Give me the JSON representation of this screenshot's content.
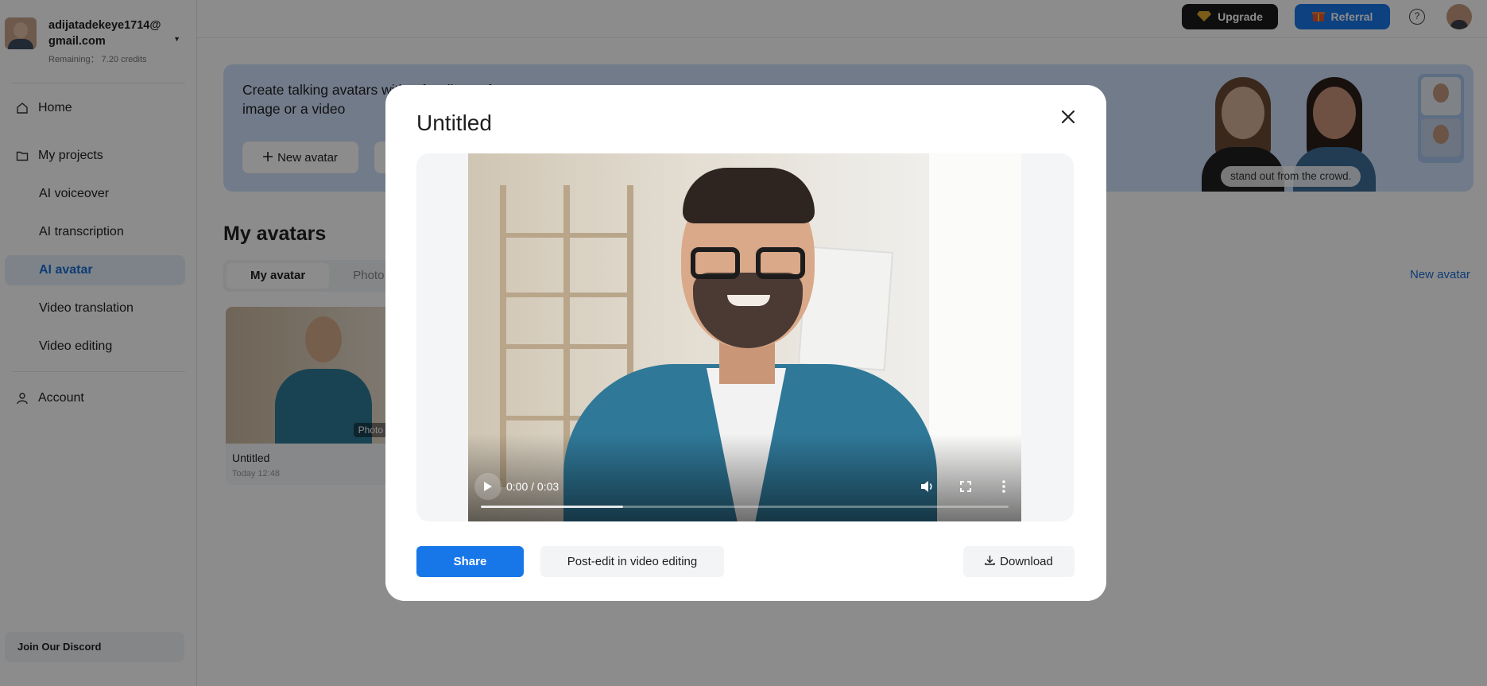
{
  "account": {
    "email": "adijatadekeye1714@gmail.com",
    "credits": "Remaining： 7.20 credits"
  },
  "sidebar": {
    "items": [
      {
        "label": "Home",
        "icon": "home-icon"
      },
      {
        "label": "My projects",
        "icon": "folder-icon"
      },
      {
        "label": "AI voiceover"
      },
      {
        "label": "AI transcription"
      },
      {
        "label": "AI avatar",
        "active": true
      },
      {
        "label": "Video translation"
      },
      {
        "label": "Video editing"
      },
      {
        "label": "Account",
        "icon": "user-icon"
      }
    ],
    "discord_label": "Join Our Discord"
  },
  "topbar": {
    "upgrade_label": "Upgrade",
    "referral_label": "Referral",
    "help_icon": "?"
  },
  "banner": {
    "text": "Create talking avatars with a few lines of text or an image or a video",
    "new_avatar_label": "New avatar",
    "tagline": "stand out from the crowd."
  },
  "main": {
    "section_title": "My avatars",
    "tabs": [
      {
        "label": "My avatar",
        "active": true
      },
      {
        "label": "Photo"
      }
    ],
    "new_avatar_link": "New avatar",
    "card": {
      "name": "Untitled",
      "time": "Today 12:48",
      "badge": "Photo"
    }
  },
  "modal": {
    "title": "Untitled",
    "player": {
      "time": "0:00 / 0:03",
      "buffered_fraction": 0.27
    },
    "share_label": "Share",
    "postedit_label": "Post-edit in video editing",
    "download_label": "Download"
  },
  "colors": {
    "accent": "#1877e8",
    "active_text": "#1b6ed4",
    "active_bg": "#e6eefb",
    "banner_bg": "#cfe1fb"
  }
}
